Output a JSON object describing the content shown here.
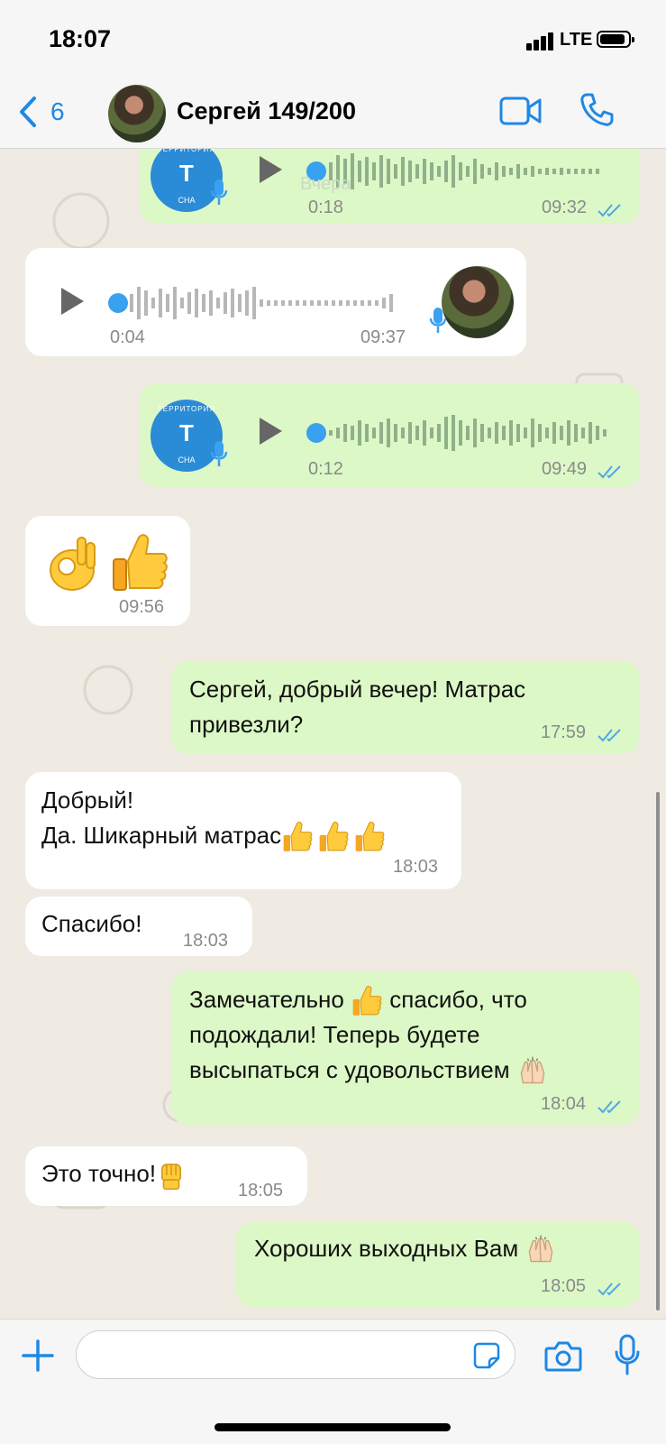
{
  "status_bar": {
    "time": "18:07",
    "network": "LTE",
    "battery_level": 0.85
  },
  "header": {
    "back_count": "6",
    "contact_name": "Сергей 149/200"
  },
  "voice_logo": {
    "top": "ТЕРРИТОРИЯ",
    "letter": "Т",
    "bottom": "СНА"
  },
  "date_overlay": "Вчера",
  "messages": [
    {
      "type": "voice",
      "direction": "out",
      "duration": "0:18",
      "time": "09:32"
    },
    {
      "type": "voice",
      "direction": "in",
      "duration": "0:04",
      "time": "09:37"
    },
    {
      "type": "voice",
      "direction": "out",
      "duration": "0:12",
      "time": "09:49"
    },
    {
      "type": "emoji",
      "direction": "in",
      "time": "09:56"
    },
    {
      "type": "text",
      "direction": "out",
      "lines": [
        "Сергей, добрый вечер! Матрас",
        "привезли?"
      ],
      "time": "17:59"
    },
    {
      "type": "text",
      "direction": "in",
      "lines": [
        "Добрый!",
        "Да. Шикарный матрас"
      ],
      "time": "18:03"
    },
    {
      "type": "text",
      "direction": "in",
      "lines": [
        "Спасибо!"
      ],
      "time": "18:03"
    },
    {
      "type": "text",
      "direction": "out",
      "lines": [
        "Замечательно",
        "спасибо, что",
        "подождали! Теперь будете",
        "высыпаться с удовольствием"
      ],
      "time": "18:04"
    },
    {
      "type": "text",
      "direction": "in",
      "lines": [
        "Это точно!"
      ],
      "time": "18:05"
    },
    {
      "type": "text",
      "direction": "out",
      "lines": [
        "Хороших выходных Вам"
      ],
      "time": "18:05"
    }
  ],
  "colors": {
    "accent": "#1e88e5",
    "outgoing_bubble": "#dcf8c6",
    "incoming_bubble": "#ffffff",
    "chat_bg": "#efeae2",
    "read_ticks": "#4fa7e6"
  },
  "icons": [
    "chevron-left-icon",
    "video-call-icon",
    "phone-icon",
    "plus-icon",
    "sticker-icon",
    "camera-icon",
    "mic-icon",
    "play-icon",
    "ok-hand-emoji",
    "thumbs-up-emoji",
    "raised-fist-emoji",
    "raising-hands-emoji"
  ]
}
